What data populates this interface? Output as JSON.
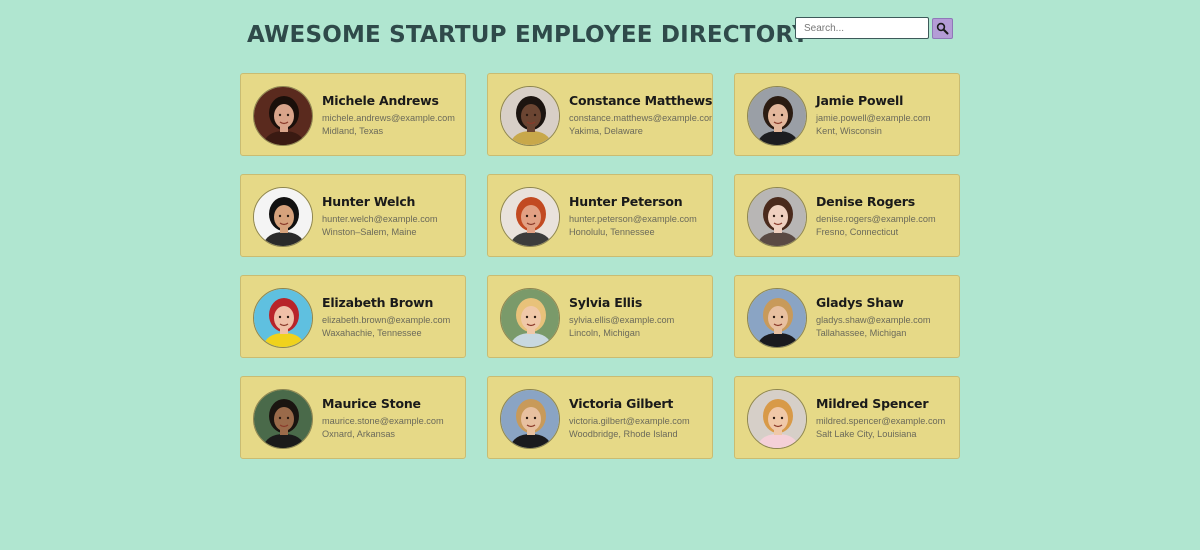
{
  "header": {
    "title": "AWESOME STARTUP EMPLOYEE DIRECTORY",
    "search_placeholder": "Search...",
    "search_value": "",
    "search_icon": "magnifier-icon"
  },
  "colors": {
    "background": "#b0e6d0",
    "card": "#e6d987",
    "search_button": "#b49cd6",
    "title": "#2f4a4a"
  },
  "employees": [
    {
      "name": "Michele Andrews",
      "email": "michele.andrews@example.com",
      "location": "Midland, Texas",
      "avatar": {
        "bg": "#5a2a1e",
        "skin": "#d9a48a",
        "hair": "#1a0f0a",
        "shirt": "#3a1a12"
      }
    },
    {
      "name": "Constance Matthews",
      "email": "constance.matthews@example.com",
      "location": "Yakima, Delaware",
      "avatar": {
        "bg": "#d8cfc7",
        "skin": "#6b4532",
        "hair": "#1c1410",
        "shirt": "#c8a84a"
      }
    },
    {
      "name": "Jamie Powell",
      "email": "jamie.powell@example.com",
      "location": "Kent, Wisconsin",
      "avatar": {
        "bg": "#9a9fa6",
        "skin": "#e4b89c",
        "hair": "#2b1c12",
        "shirt": "#1d1d20"
      }
    },
    {
      "name": "Hunter Welch",
      "email": "hunter.welch@example.com",
      "location": "Winston–Salem, Maine",
      "avatar": {
        "bg": "#f4f4f4",
        "skin": "#d6a27c",
        "hair": "#111111",
        "shirt": "#2a2a2a"
      }
    },
    {
      "name": "Hunter Peterson",
      "email": "hunter.peterson@example.com",
      "location": "Honolulu, Tennessee",
      "avatar": {
        "bg": "#e9e2dc",
        "skin": "#e2a184",
        "hair": "#c24a22",
        "shirt": "#3c3c3c"
      }
    },
    {
      "name": "Denise Rogers",
      "email": "denise.rogers@example.com",
      "location": "Fresno, Connecticut",
      "avatar": {
        "bg": "#b8b6b5",
        "skin": "#efd0c0",
        "hair": "#4a2a1c",
        "shirt": "#5a4a44"
      }
    },
    {
      "name": "Elizabeth Brown",
      "email": "elizabeth.brown@example.com",
      "location": "Waxahachie, Tennessee",
      "avatar": {
        "bg": "#5fc0e0",
        "skin": "#f0c0a8",
        "hair": "#b8242a",
        "shirt": "#f0d21c"
      }
    },
    {
      "name": "Sylvia Ellis",
      "email": "sylvia.ellis@example.com",
      "location": "Lincoln, Michigan",
      "avatar": {
        "bg": "#7a9a6a",
        "skin": "#f0c8a8",
        "hair": "#e8c27a",
        "shirt": "#c8d8e0"
      }
    },
    {
      "name": "Gladys Shaw",
      "email": "gladys.shaw@example.com",
      "location": "Tallahassee, Michigan",
      "avatar": {
        "bg": "#8aa4c4",
        "skin": "#e8c0a0",
        "hair": "#c89a5a",
        "shirt": "#1a1a1e"
      }
    },
    {
      "name": "Maurice Stone",
      "email": "maurice.stone@example.com",
      "location": "Oxnard, Arkansas",
      "avatar": {
        "bg": "#4a6a4a",
        "skin": "#9a6a4a",
        "hair": "#1a1410",
        "shirt": "#1a1a1a"
      }
    },
    {
      "name": "Victoria Gilbert",
      "email": "victoria.gilbert@example.com",
      "location": "Woodbridge, Rhode Island",
      "avatar": {
        "bg": "#8aa4c4",
        "skin": "#e8c0a0",
        "hair": "#c89a5a",
        "shirt": "#1a1a1e"
      }
    },
    {
      "name": "Mildred Spencer",
      "email": "mildred.spencer@example.com",
      "location": "Salt Lake City, Louisiana",
      "avatar": {
        "bg": "#d6cfc8",
        "skin": "#f0c8a8",
        "hair": "#d89a48",
        "shirt": "#f4d0d8"
      }
    }
  ]
}
